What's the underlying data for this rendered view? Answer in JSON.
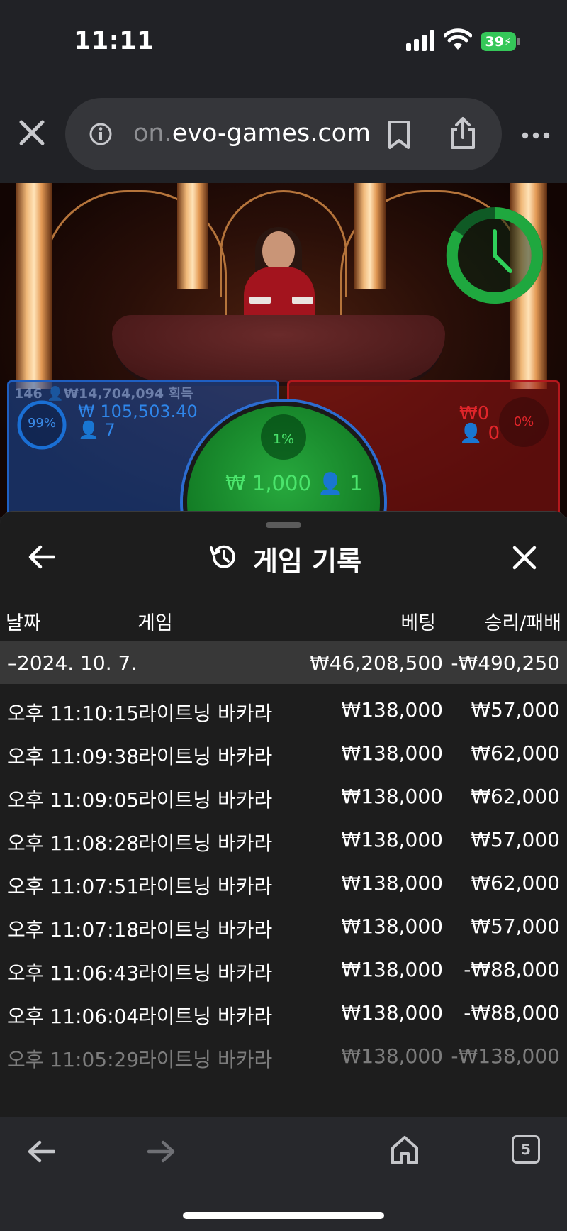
{
  "status": {
    "time": "11:11",
    "battery": "39"
  },
  "browser": {
    "url_faded": "on.",
    "url_main": "evo-games.com",
    "tab_count": "5"
  },
  "game_overlay": {
    "blue_header": "146 👤₩14,704,094 획득",
    "blue_percent": "99%",
    "blue_amount": "₩ 105,503.40",
    "blue_players": "7",
    "red_amount": "₩0",
    "red_players": "0",
    "red_percent": "0%",
    "tie_percent": "1%",
    "tie_amount": "₩ 1,000",
    "tie_players": "1"
  },
  "history": {
    "title": "게임 기록",
    "columns": {
      "date": "날짜",
      "game": "게임",
      "bet": "베팅",
      "result": "승리/패배"
    },
    "date_group": {
      "date": "–2024. 10. 7.",
      "bet_total": "₩46,208,500",
      "result_total": "-₩490,250"
    },
    "rows": [
      {
        "time": "오후 11:10:15",
        "game": "라이트닝 바카라",
        "bet": "₩138,000",
        "result": "₩57,000"
      },
      {
        "time": "오후 11:09:38",
        "game": "라이트닝 바카라",
        "bet": "₩138,000",
        "result": "₩62,000"
      },
      {
        "time": "오후 11:09:05",
        "game": "라이트닝 바카라",
        "bet": "₩138,000",
        "result": "₩62,000"
      },
      {
        "time": "오후 11:08:28",
        "game": "라이트닝 바카라",
        "bet": "₩138,000",
        "result": "₩57,000"
      },
      {
        "time": "오후 11:07:51",
        "game": "라이트닝 바카라",
        "bet": "₩138,000",
        "result": "₩62,000"
      },
      {
        "time": "오후 11:07:18",
        "game": "라이트닝 바카라",
        "bet": "₩138,000",
        "result": "₩57,000"
      },
      {
        "time": "오후 11:06:43",
        "game": "라이트닝 바카라",
        "bet": "₩138,000",
        "result": "-₩88,000"
      },
      {
        "time": "오후 11:06:04",
        "game": "라이트닝 바카라",
        "bet": "₩138,000",
        "result": "-₩88,000"
      },
      {
        "time": "오후 11:05:29",
        "game": "라이트닝 바카라",
        "bet": "₩138,000",
        "result": "-₩138,000"
      }
    ]
  },
  "colors": {
    "blue": "#2f86ea",
    "red": "#e0252a",
    "green": "#4be56c",
    "sheet_bg": "#1d1d1d"
  },
  "icons": [
    "close-icon",
    "info-icon",
    "bookmark-icon",
    "share-icon",
    "more-icon",
    "timer-icon",
    "back-arrow-icon",
    "history-icon",
    "home-icon",
    "forward-arrow-icon"
  ]
}
